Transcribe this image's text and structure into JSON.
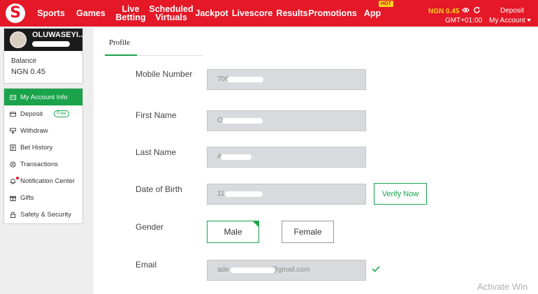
{
  "nav": {
    "logo": "S",
    "items": [
      "Sports",
      "Games",
      "Live Betting",
      "Scheduled Virtuals",
      "Jackpot",
      "Livescore",
      "Results",
      "Promotions",
      "App"
    ],
    "hot_badge": "HOT",
    "balance": "NGN 0.45",
    "timezone": "GMT+01:00",
    "deposit": "Deposit",
    "my_account": "My Account"
  },
  "user": {
    "name": "OLUWASEYI...",
    "balance_label": "Balance",
    "balance_value": "NGN 0.45"
  },
  "menu": [
    {
      "label": "My Account Info",
      "icon": "user-card-icon",
      "active": true
    },
    {
      "label": "Deposit",
      "icon": "card-icon",
      "badge": "Free"
    },
    {
      "label": "Withdraw",
      "icon": "withdraw-icon"
    },
    {
      "label": "Bet History",
      "icon": "history-icon"
    },
    {
      "label": "Transactions",
      "icon": "transactions-icon"
    },
    {
      "label": "Notification Center",
      "icon": "bell-icon"
    },
    {
      "label": "Gifts",
      "icon": "gift-icon"
    },
    {
      "label": "Safety & Security",
      "icon": "lock-icon"
    }
  ],
  "profile": {
    "tab": "Profile",
    "fields": {
      "mobile_label": "Mobile Number",
      "mobile_value": "706",
      "first_label": "First Name",
      "first_value": "O",
      "last_label": "Last Name",
      "last_value": "A",
      "dob_label": "Date of Birth",
      "dob_value": "11",
      "gender_label": "Gender",
      "email_label": "Email",
      "email_prefix": "ade",
      "email_suffix": "@gmail.com"
    },
    "verify_button": "Verify Now",
    "gender_male": "Male",
    "gender_female": "Female"
  },
  "watermark": "Activate Win",
  "colors": {
    "brand_red": "#e41827",
    "accent_green": "#1aa34a",
    "balance_yellow": "#ffd21f"
  }
}
